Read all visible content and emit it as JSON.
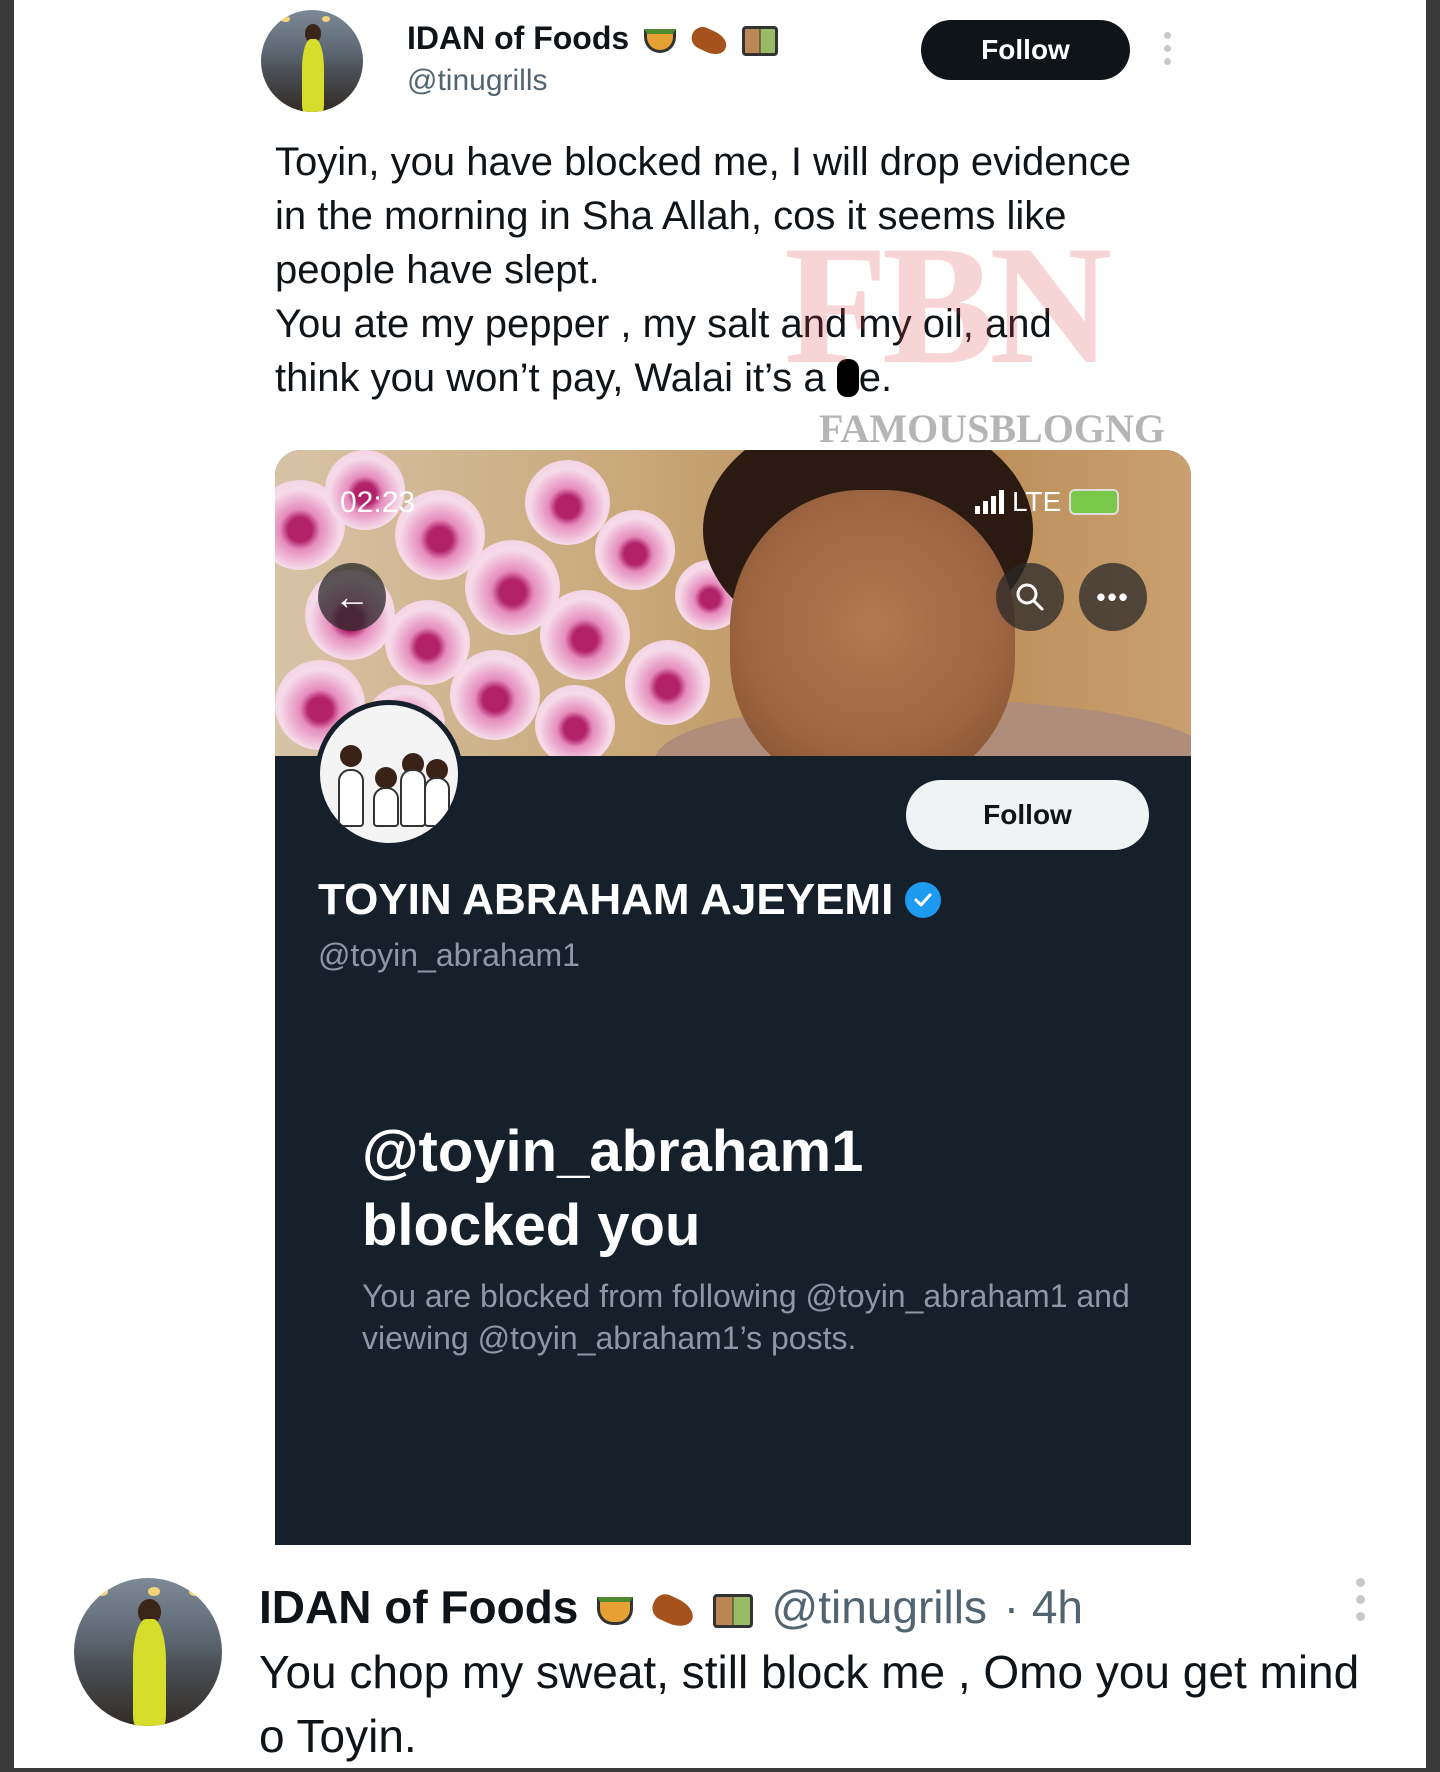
{
  "top_tweet": {
    "author_name": "IDAN of Foods",
    "handle": "@tinugrills",
    "follow_label": "Follow",
    "lines": [
      "Toyin, you have blocked me, I will drop evidence",
      "in the morning in Sha Allah, cos it seems like",
      "people have slept.",
      "You ate my pepper , my salt and my oil, and",
      "think you won’t pay, Walai it’s a"
    ],
    "last_line_tail": "e."
  },
  "watermark": {
    "letters": "FBN",
    "text": "FAMOUSBLOGNG"
  },
  "embedded_profile": {
    "status_time": "02:23",
    "network": "LTE",
    "follow_label": "Follow",
    "name": "TOYIN ABRAHAM AJEYEMI",
    "handle": "@toyin_abraham1",
    "blocked_title_1": "@toyin_abraham1",
    "blocked_title_2": "blocked you",
    "blocked_sub": "You are blocked from following @toyin_abraham1 and viewing @toyin_abraham1’s posts.",
    "back_icon": "←",
    "more_icon": "•••"
  },
  "reply_tweet": {
    "author_name": "IDAN of Foods",
    "handle": "@tinugrills",
    "time": "· 4h",
    "text": "You chop my sweat, still block me , Omo you get mind o Toyin."
  },
  "colors": {
    "dark_bg": "#15202b",
    "accent_blue": "#1d9bf0",
    "text_primary": "#0f1419",
    "text_secondary": "#536471"
  },
  "icons": [
    "bowl-emoji-icon",
    "drumstick-emoji-icon",
    "bento-box-emoji-icon",
    "back-arrow-icon",
    "search-icon",
    "more-icon",
    "verified-badge-icon",
    "kebab-menu-icon"
  ]
}
